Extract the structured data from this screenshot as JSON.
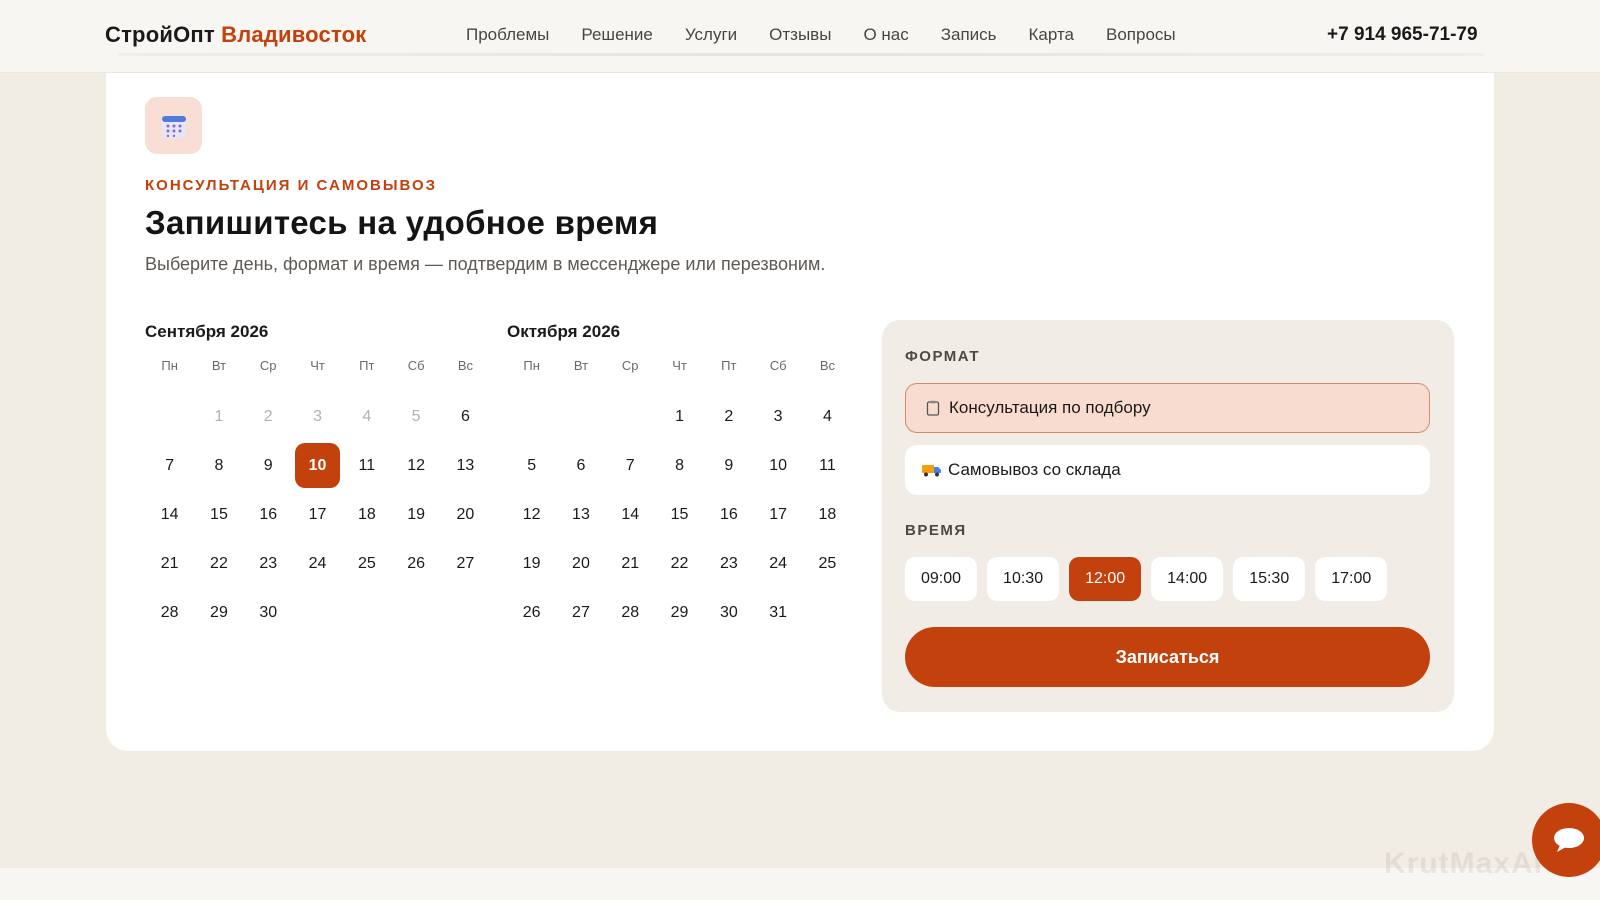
{
  "header": {
    "logo_main": "СтройОпт",
    "logo_city": "Владивосток",
    "nav": [
      "Проблемы",
      "Решение",
      "Услуги",
      "Отзывы",
      "О нас",
      "Запись",
      "Карта",
      "Вопросы"
    ],
    "phone": "+7 914 965-71-79"
  },
  "hero": {
    "icon": "calendar-icon",
    "eyebrow": "КОНСУЛЬТАЦИЯ И САМОВЫВОЗ",
    "title": "Запишитесь на удобное время",
    "subtitle": "Выберите день, формат и время — подтвердим в мессенджере или перезвоним."
  },
  "weekdays": [
    "Пн",
    "Вт",
    "Ср",
    "Чт",
    "Пт",
    "Сб",
    "Вс"
  ],
  "calendars": [
    {
      "title": "Сентября 2026",
      "offset": 1,
      "days": [
        "1",
        "2",
        "3",
        "4",
        "5",
        "6",
        "7",
        "8",
        "9",
        "10",
        "11",
        "12",
        "13",
        "14",
        "15",
        "16",
        "17",
        "18",
        "19",
        "20",
        "21",
        "22",
        "23",
        "24",
        "25",
        "26",
        "27",
        "28",
        "29",
        "30"
      ],
      "muted": [
        "1",
        "2",
        "3",
        "4",
        "5"
      ],
      "selected": "10"
    },
    {
      "title": "Октября 2026",
      "offset": 3,
      "days": [
        "1",
        "2",
        "3",
        "4",
        "5",
        "6",
        "7",
        "8",
        "9",
        "10",
        "11",
        "12",
        "13",
        "14",
        "15",
        "16",
        "17",
        "18",
        "19",
        "20",
        "21",
        "22",
        "23",
        "24",
        "25",
        "26",
        "27",
        "28",
        "29",
        "30",
        "31"
      ],
      "muted": [],
      "selected": ""
    }
  ],
  "panel": {
    "format_label": "ФОРМАТ",
    "options": [
      {
        "label": "Консультация по подбору",
        "icon": "clipboard-icon",
        "active": true
      },
      {
        "label": "Самовывоз со склада",
        "icon": "truck-icon",
        "active": false
      }
    ],
    "time_label": "ВРЕМЯ",
    "times": [
      "09:00",
      "10:30",
      "12:00",
      "14:00",
      "15:30",
      "17:00"
    ],
    "selected_time": "12:00",
    "submit": "Записаться"
  },
  "watermark": "KrutMaxAI",
  "colors": {
    "accent": "#c2410c",
    "background": "#f1ece4",
    "panel": "#f1ede6"
  }
}
